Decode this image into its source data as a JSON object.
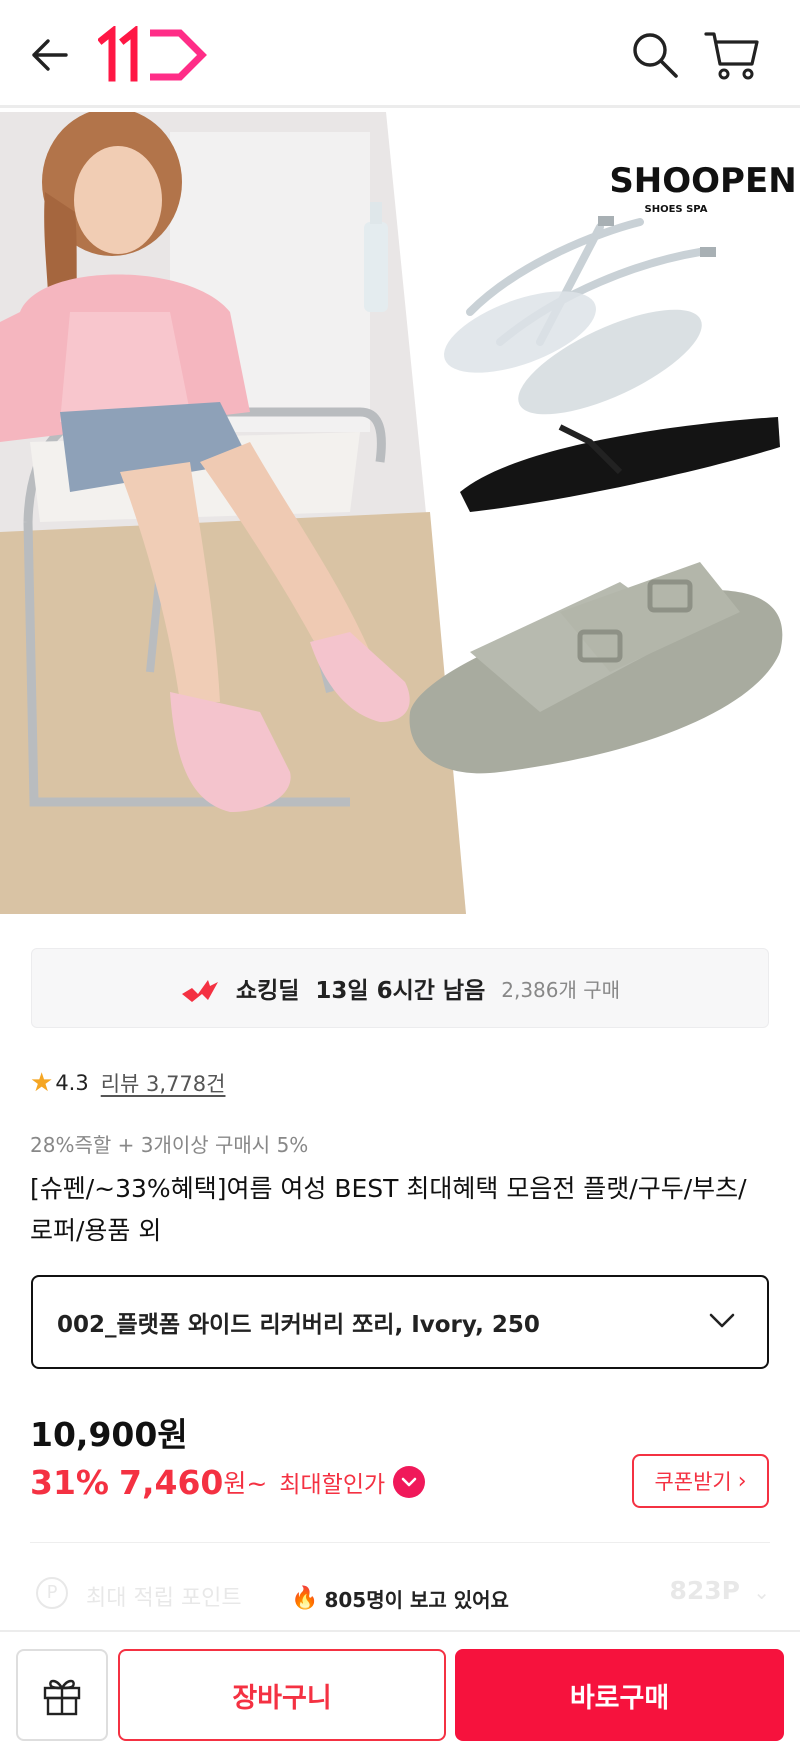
{
  "header": {
    "back_icon": "arrow-left-icon",
    "logo_text": "11",
    "search_icon": "search-icon",
    "cart_icon": "cart-icon"
  },
  "hero": {
    "brand_name": "SHOOPEN",
    "brand_sub": "SHOES SPA"
  },
  "deal": {
    "icon": "shocking-deal-icon",
    "title": "쇼킹딜",
    "remaining": "13일 6시간 남음",
    "purchase_count": "2,386개 구매"
  },
  "rating": {
    "star": "★",
    "value": "4.3",
    "review_link": "리뷰 3,778건"
  },
  "benefit_line": "28%즉할 + 3개이상 구매시 5%",
  "product_title": "[슈펜/~33%혜택]여름 여성 BEST 최대혜택 모음전 플랫/구두/부츠/로퍼/용품 외",
  "option": {
    "selected": "002_플랫폼 와이드 리커버리 쪼리, Ivory, 250"
  },
  "price": {
    "original": "10,900원",
    "discount_rate": "31%",
    "sale_price": "7,460",
    "suffix": "원~",
    "max_discount_label": "최대할인가"
  },
  "coupon_button": "쿠폰받기",
  "points": {
    "icon_letter": "P",
    "label": "최대 적립 포인트",
    "value": "823P"
  },
  "viewers": {
    "text": "805명이 보고 있어요"
  },
  "bottom_bar": {
    "gift_icon": "gift-icon",
    "cart_label": "장바구니",
    "buy_label": "바로구매"
  },
  "colors": {
    "accent_red": "#f43142",
    "buy_button": "#f6123d",
    "logo_red": "#ff1744",
    "logo_pink": "#ff2d87"
  }
}
